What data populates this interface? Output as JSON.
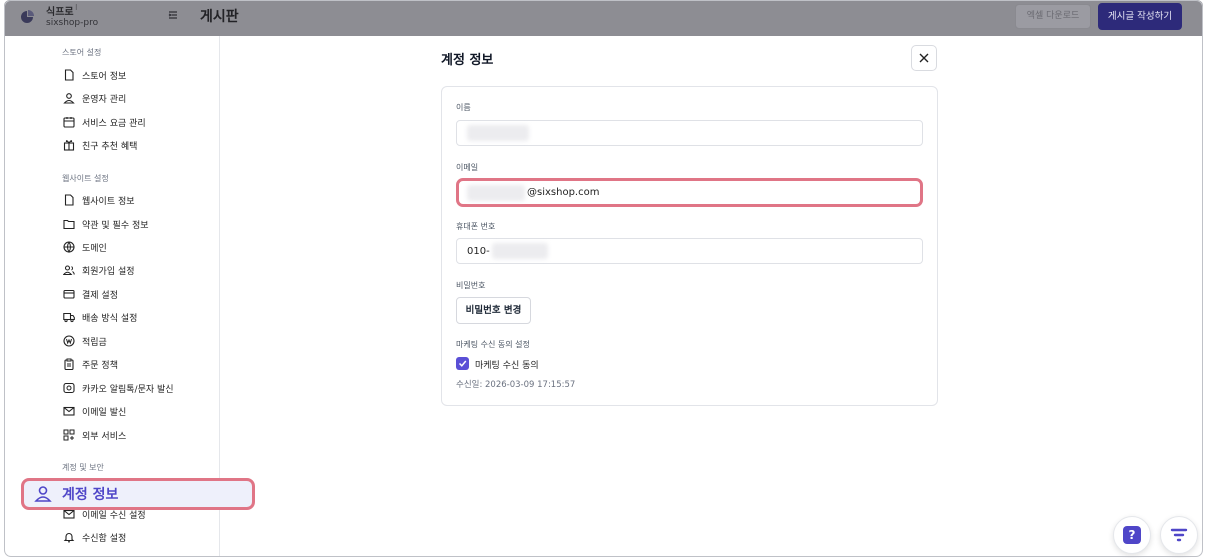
{
  "topbar": {
    "store_name": "식프로",
    "store_caret": "⁝",
    "store_id": "sixshop-pro",
    "collapse_icon": "collapse-sidebar-icon",
    "page_title": "게시판",
    "excel_label": "엑셀 다운로드",
    "write_label": "게시글 작성하기"
  },
  "sidebar": {
    "store_section": "스토어 설정",
    "store_items": [
      {
        "label": "스토어 정보",
        "icon": "document-icon"
      },
      {
        "label": "운영자 관리",
        "icon": "user-icon"
      },
      {
        "label": "서비스 요금 관리",
        "icon": "calendar-icon"
      },
      {
        "label": "친구 추천 혜택",
        "icon": "gift-icon"
      }
    ],
    "website_section": "웹사이트 설정",
    "website_items": [
      {
        "label": "웹사이트 정보",
        "icon": "document-icon"
      },
      {
        "label": "약관 및 필수 정보",
        "icon": "folder-icon"
      },
      {
        "label": "도메인",
        "icon": "globe-icon"
      },
      {
        "label": "회원가입 설정",
        "icon": "users-icon"
      },
      {
        "label": "결제 설정",
        "icon": "card-icon"
      },
      {
        "label": "배송 방식 설정",
        "icon": "truck-icon"
      },
      {
        "label": "적립금",
        "icon": "coin-icon"
      },
      {
        "label": "주문 정책",
        "icon": "clipboard-icon"
      },
      {
        "label": "카카오 알림톡/문자 발신",
        "icon": "chat-icon"
      },
      {
        "label": "이메일 발신",
        "icon": "mail-icon"
      },
      {
        "label": "외부 서비스",
        "icon": "apps-icon"
      }
    ],
    "account_section": "계정 및 보안",
    "active_item": {
      "label": "계정 정보",
      "icon": "user-icon"
    },
    "account_items": [
      {
        "label": "이메일 수신 설정",
        "icon": "mail-icon"
      },
      {
        "label": "수신함 설정",
        "icon": "bell-icon"
      }
    ]
  },
  "main": {
    "title": "계정 정보",
    "close_icon": "close-icon",
    "name_label": "이름",
    "email_label": "이메일",
    "email_value": "@sixshop.com",
    "phone_label": "휴대폰 번호",
    "phone_value": "010-",
    "password_label": "비밀번호",
    "password_button": "비밀번호 변경",
    "marketing_label": "마케팅 수신 동의 설정",
    "marketing_checkbox_label": "마케팅 수신 동의",
    "marketing_checked": true,
    "consent_date": "수신일:  2026-03-09 17:15:57"
  },
  "floating": {
    "help_label": "?",
    "help_icon": "help-icon",
    "menu_icon": "menu-icon"
  },
  "colors": {
    "accent": "#4f46c8",
    "highlight": "#e07586",
    "overlay": "#8d8d93"
  }
}
